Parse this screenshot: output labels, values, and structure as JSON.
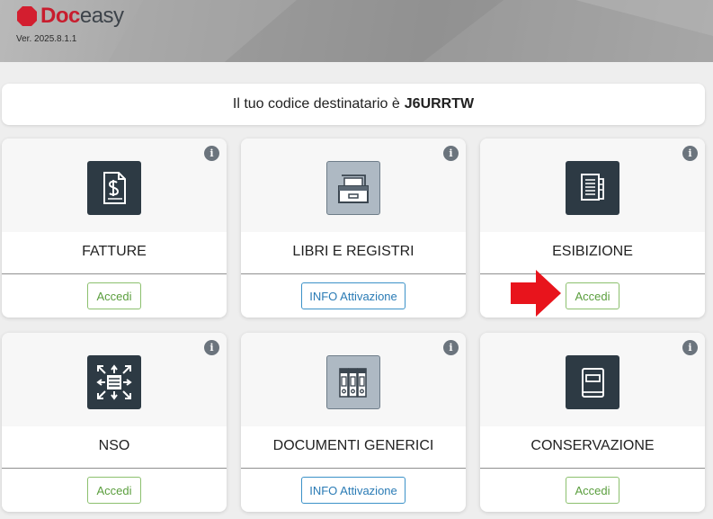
{
  "header": {
    "brand_part1": "Doc",
    "brand_part2": "easy",
    "version": "Ver. 2025.8.1.1"
  },
  "destinatario": {
    "prefix": "Il tuo codice destinatario è",
    "code": "J6URRTW"
  },
  "cards": [
    {
      "title": "FATTURE",
      "button": "Accedi",
      "icon": "invoice-dollar-icon"
    },
    {
      "title": "LIBRI E REGISTRI",
      "button": "INFO Attivazione",
      "icon": "archive-drawer-icon"
    },
    {
      "title": "ESIBIZIONE",
      "button": "Accedi",
      "icon": "documents-stack-icon"
    },
    {
      "title": "NSO",
      "button": "Accedi",
      "icon": "document-arrows-icon"
    },
    {
      "title": "DOCUMENTI GENERICI",
      "button": "INFO Attivazione",
      "icon": "binders-icon"
    },
    {
      "title": "CONSERVAZIONE",
      "button": "Accedi",
      "icon": "book-icon"
    }
  ],
  "info_icon": "info-icon",
  "annotation": {
    "icon": "red-arrow-icon",
    "color": "#e8141c"
  },
  "colors": {
    "accedi": "#5a9e3d",
    "info_attivazione": "#2a7bb5",
    "brand_red": "#c81d2e"
  }
}
